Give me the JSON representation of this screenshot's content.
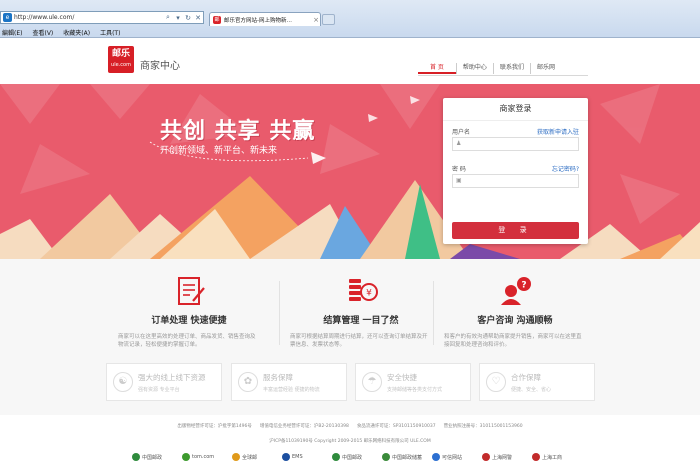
{
  "browser": {
    "url": "http://www.ule.com/",
    "tab_title": "邮乐官方网站-网上购物新…",
    "menu": [
      "編輯(E)",
      "查看(V)",
      "收藏夹(A)",
      "工具(T)"
    ],
    "favicon": "e",
    "tab_favicon": "邮"
  },
  "header": {
    "logo_top": "邮乐",
    "logo_bottom": "ule.com",
    "site_name": "商家中心",
    "nav": [
      "首 页",
      "帮助中心",
      "联系我们",
      "邮乐网"
    ]
  },
  "hero": {
    "slogan": "共创 共享 共赢",
    "sub_slogan": "开创新领域、新平台、新未来",
    "colors": {
      "bg": "#e95b6c",
      "orange": "#f4a261",
      "cream": "#f6dcc0",
      "green": "#3fbf86",
      "purple": "#7b4aa8"
    }
  },
  "login": {
    "title": "商家登录",
    "username_label": "用户名",
    "username_link": "获取新申请入驻",
    "password_label": "密 码",
    "password_link": "忘记密码?",
    "button": "登 录"
  },
  "features": [
    {
      "title": "订单处理 快速便捷",
      "icon": "order-icon",
      "desc": "商家可以在这里高效的处理订单、商品发货、销售查询及物流记录，轻松便捷的掌握订单。"
    },
    {
      "title": "结算管理 一目了然",
      "icon": "settlement-icon",
      "desc": "商家可根据结算周期进行结算，还可以查询订单结算及开票信息、发票状态等。"
    },
    {
      "title": "客户咨询 沟通顺畅",
      "icon": "support-icon",
      "desc": "和客户的有效沟通帮助商家提升销售，商家可以在这里直接回复和处理咨询和评价。"
    }
  ],
  "boxes": [
    {
      "title": "强大的线上线下资源",
      "desc": "强有资源 专业平台"
    },
    {
      "title": "服务保障",
      "desc": "丰富运营经验 便捷的物流"
    },
    {
      "title": "安全快捷",
      "desc": "支持邮储等各类支付方式"
    },
    {
      "title": "合作保障",
      "desc": "便捷、安全、省心"
    }
  ],
  "footer": {
    "licenses": [
      "出版物经营许可证：沪批字第1496号",
      "增值电信业务经营许可证：沪B2-20130398",
      "食品流通许可证：SP3101150910037",
      "营业执照注册号：310115001153960"
    ],
    "copyright": "沪ICP备11039190号  Copyright 2009-2015 邮乐网络科技有限公司 ULE.COM",
    "partners": [
      {
        "name": "中国邮政",
        "color": "#2f8b3d"
      },
      {
        "name": "tom.com",
        "color": "#3d9a2e"
      },
      {
        "name": "全球邮",
        "color": "#e09a1b"
      },
      {
        "name": "EMS",
        "color": "#1c4fa0"
      },
      {
        "name": "中国邮政",
        "color": "#2f8b3d"
      },
      {
        "name": "中国邮政储蓄",
        "color": "#3a8a3a"
      },
      {
        "name": "可信网站",
        "color": "#2c6fd1"
      },
      {
        "name": "上海网警",
        "color": "#c22b2b"
      },
      {
        "name": "上海工商",
        "color": "#c22b2b"
      }
    ]
  }
}
